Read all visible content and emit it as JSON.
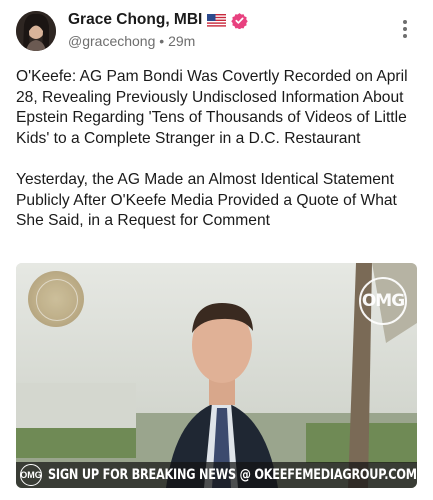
{
  "post": {
    "author": {
      "display_name": "Grace Chong, MBI",
      "flag_icon": "us-flag-icon",
      "verified_icon": "verified-badge-icon",
      "handle": "@gracechong",
      "separator": "•",
      "time_ago": "29m"
    },
    "body": {
      "paragraph_1": "O'Keefe: AG Pam Bondi Was Covertly Recorded on April 28, Revealing Previously Undisclosed Information About Epstein Regarding 'Tens of Thousands of Videos of Little Kids' to a Complete Stranger in a D.C. Restaurant",
      "paragraph_2": "Yesterday, the AG Made an Almost Identical Statement Publicly After O'Keefe Media Provided a Quote of What She Said, in a Request for Comment"
    },
    "media": {
      "watermark": "OMG",
      "banner_logo": "OMG",
      "banner_text": "SIGN UP FOR BREAKING NEWS @ OKEEFEMEDIAGROUP.COM"
    }
  },
  "colors": {
    "verified": "#e8417f",
    "text_primary": "#1a1a1a",
    "text_secondary": "#6e6e6e"
  }
}
